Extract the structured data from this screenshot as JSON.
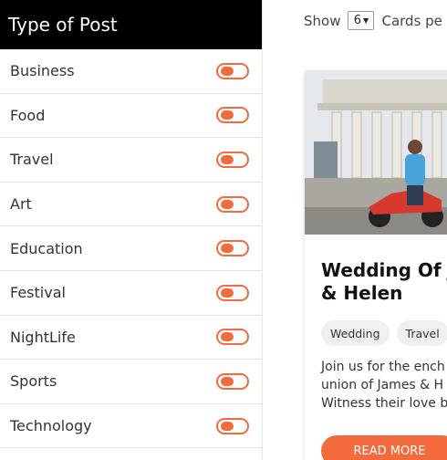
{
  "sidebar": {
    "title": "Type of Post",
    "items": [
      {
        "label": "Business"
      },
      {
        "label": "Food"
      },
      {
        "label": "Travel"
      },
      {
        "label": "Art"
      },
      {
        "label": "Education"
      },
      {
        "label": "Festival"
      },
      {
        "label": "NightLife"
      },
      {
        "label": "Sports"
      },
      {
        "label": "Technology"
      }
    ]
  },
  "toolbar": {
    "show_label": "Show",
    "per_page_value": "6",
    "cards_per_label": "Cards pe"
  },
  "card": {
    "title": "Wedding Of J\n& Helen",
    "tags": [
      "Wedding",
      "Travel"
    ],
    "description": "Join us for the ench\nunion of James & H\nWitness their love b",
    "button_label": "READ MORE"
  },
  "colors": {
    "accent": "#f26a3d",
    "header_bg": "#000000"
  }
}
